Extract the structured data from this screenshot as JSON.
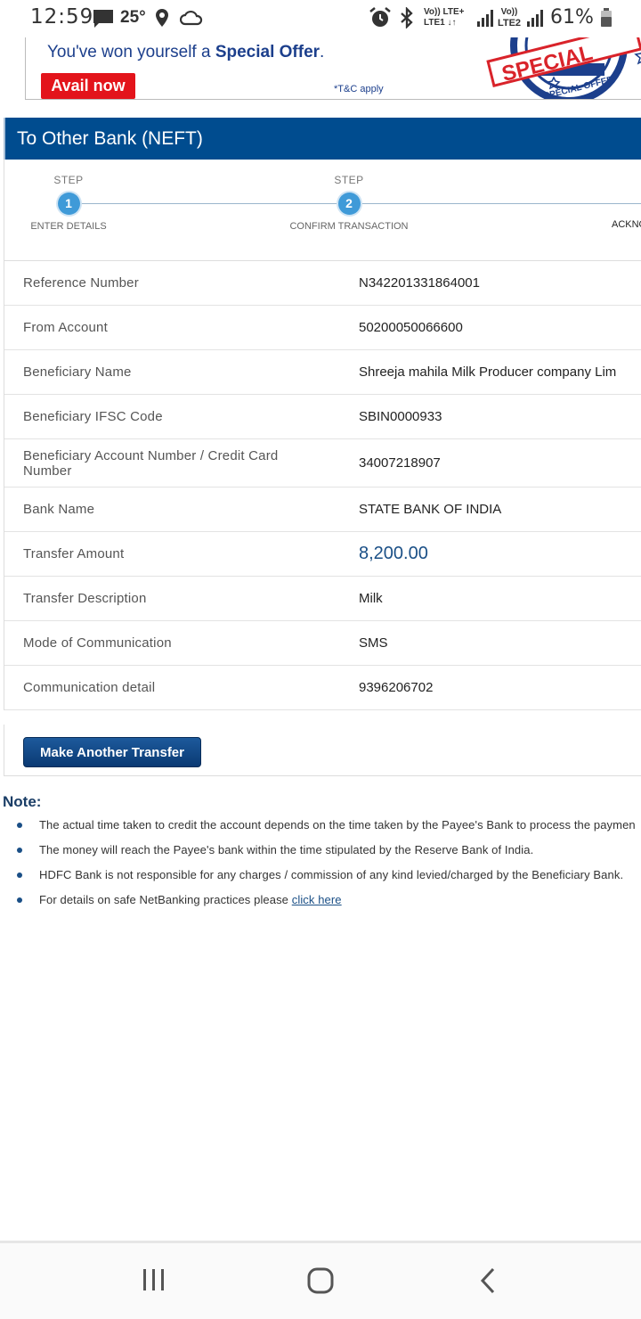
{
  "status_bar": {
    "time": "12:59",
    "temperature": "25°",
    "sim1_top": "Vo)) LTE+",
    "sim1_bottom": "LTE1 ↓↑",
    "sim2_top": "Vo))",
    "sim2_bottom": "LTE2",
    "battery": "61%",
    "icons": [
      "message-icon",
      "location-icon",
      "cloud-icon",
      "alarm-icon",
      "bluetooth-icon",
      "signal-icon",
      "battery-icon"
    ]
  },
  "banner": {
    "text_prefix": "You've won yourself a ",
    "text_bold": "Special Offer",
    "text_suffix": ".",
    "button_label": "Avail now",
    "terms": "*T&C apply",
    "stamp_top": "SPECIAL",
    "stamp_bottom": "SPECIAL OFFER"
  },
  "header": {
    "title": "To Other Bank (NEFT)"
  },
  "stepper": {
    "steps": [
      {
        "label": "STEP",
        "number": "1",
        "caption": "ENTER DETAILS"
      },
      {
        "label": "STEP",
        "number": "2",
        "caption": "CONFIRM TRANSACTION"
      },
      {
        "label": "",
        "number": "",
        "caption": "ACKNO"
      }
    ]
  },
  "details": [
    {
      "label": "Reference Number",
      "value": "N342201331864001"
    },
    {
      "label": "From Account",
      "value": "50200050066600"
    },
    {
      "label": "Beneficiary Name",
      "value": "Shreeja mahila Milk Producer company Lim"
    },
    {
      "label": "Beneficiary IFSC Code",
      "value": "SBIN0000933"
    },
    {
      "label": "Beneficiary Account Number / Credit Card Number",
      "value": "34007218907"
    },
    {
      "label": "Bank Name",
      "value": "STATE BANK OF INDIA"
    },
    {
      "label": "Transfer Amount",
      "value": "8,200.00"
    },
    {
      "label": "Transfer Description",
      "value": "Milk"
    },
    {
      "label": "Mode of Communication",
      "value": "SMS"
    },
    {
      "label": "Communication detail",
      "value": "9396206702"
    }
  ],
  "actions": {
    "make_another_transfer": "Make Another Transfer"
  },
  "notes": {
    "title": "Note:",
    "items": [
      "The actual time taken to credit the account depends on the time taken by the Payee's Bank to process the paymen",
      "The money will reach the Payee's bank within the time stipulated by the Reserve Bank of India.",
      "HDFC Bank is not responsible for any charges / commission of any kind levied/charged by the Beneficiary Bank.",
      "For details on safe NetBanking practices please "
    ],
    "link_text": "click here"
  },
  "navbar": {
    "icons": [
      "recent-apps-icon",
      "home-icon",
      "back-icon"
    ]
  },
  "colors": {
    "header_blue": "#004c8f",
    "step_blue": "#3f9ad8",
    "offer_red": "#e3141b"
  }
}
